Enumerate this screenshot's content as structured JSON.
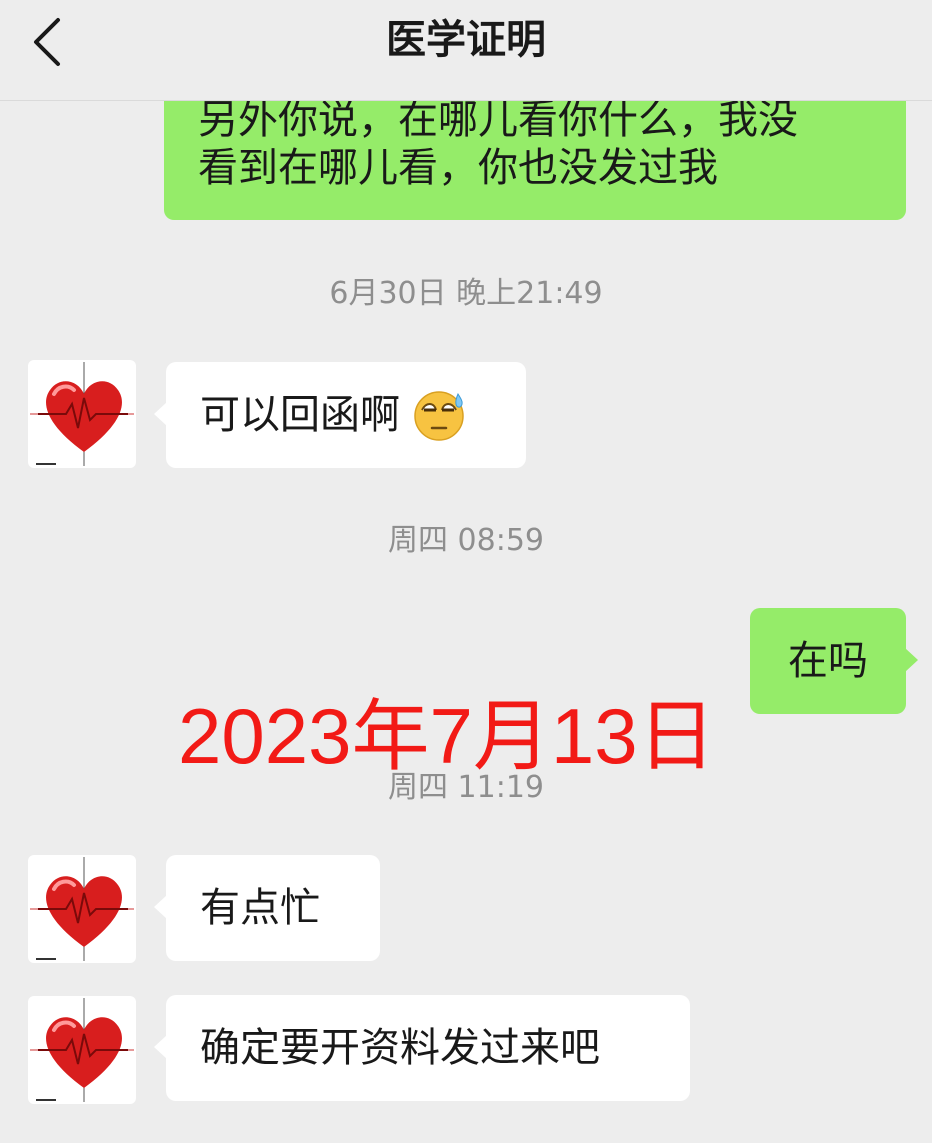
{
  "header": {
    "title": "医学证明",
    "back_icon": "chevron-left-icon"
  },
  "colors": {
    "outgoing_bubble": "#95ec69",
    "incoming_bubble": "#ffffff",
    "background": "#ededed",
    "stamp": "#f21a16"
  },
  "messages": [
    {
      "type": "outgoing",
      "lines": [
        "另外你说，在哪儿看你什么，我没",
        "看到在哪儿看，你也没发过我"
      ]
    },
    {
      "type": "time",
      "text": "6月30日 晚上21:49"
    },
    {
      "type": "incoming",
      "text": "可以回函啊",
      "emoji": "sweat-emoji"
    },
    {
      "type": "time",
      "text": "周四 08:59"
    },
    {
      "type": "outgoing",
      "text": "在吗"
    },
    {
      "type": "time",
      "text": "周四 11:19"
    },
    {
      "type": "incoming",
      "text": "有点忙"
    },
    {
      "type": "incoming",
      "text": "确定要开资料发过来吧"
    }
  ],
  "overlay": {
    "date_stamp": "2023年7月13日"
  }
}
